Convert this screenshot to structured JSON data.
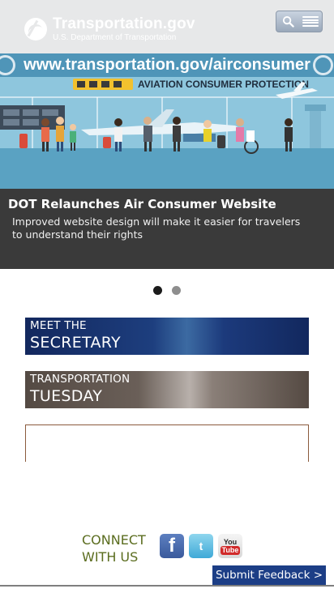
{
  "header": {
    "site_title": "Transportation.gov",
    "site_subtitle": "U.S. Department of Transportation",
    "search_icon": "search-icon",
    "menu_icon": "hamburger-menu-icon"
  },
  "hero": {
    "url_text": "www.transportation.gov/airconsumer",
    "banner_text": "AVIATION CONSUMER PROTECTION",
    "caption_title": "DOT Relaunches Air Consumer Website",
    "caption_text": "Improved website design will make it easier for travelers to understand their rights"
  },
  "carousel": {
    "slide_count": 2,
    "active_index": 0
  },
  "promos": {
    "secretary": {
      "line1": "MEET THE",
      "line2": "SECRETARY"
    },
    "tuesday": {
      "line1": "TRANSPORTATION",
      "line2": "TUESDAY"
    }
  },
  "connect": {
    "label_line1": "CONNECT",
    "label_line2": "WITH US",
    "facebook_glyph": "f",
    "twitter_glyph": "t",
    "youtube_you": "You",
    "youtube_tube": "Tube"
  },
  "feedback": {
    "label": "Submit Feedback >"
  },
  "colors": {
    "header_bg": "#e7e8e9",
    "hero_bg": "#5ba3c4",
    "caption_bg": "#3a3a3a",
    "connect_text": "#5b6d1f",
    "feedback_bg": "#1c3e86"
  }
}
